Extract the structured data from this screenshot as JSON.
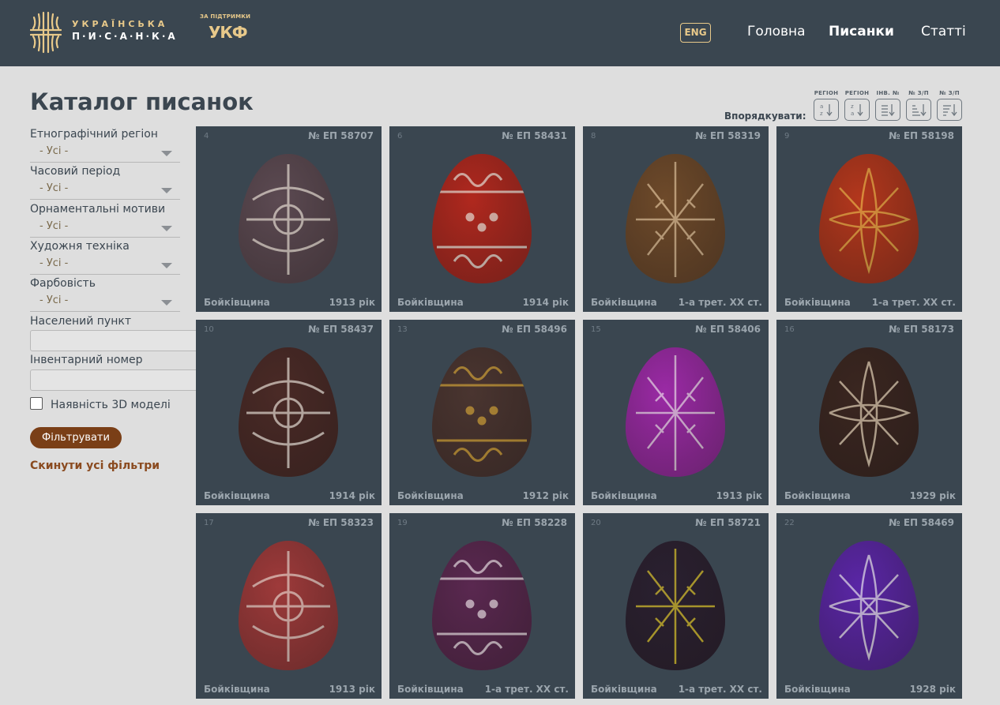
{
  "header": {
    "logo_line1": "УКРАЇНСЬКА",
    "logo_line2": "П·И·С·А·Н·К·А",
    "support_label": "ЗА ПІДТРИМКИ",
    "sponsor": "УКФ",
    "lang_button": "ENG",
    "nav": [
      {
        "label": "Головна"
      },
      {
        "label": "Писанки"
      },
      {
        "label": "Статті"
      }
    ]
  },
  "page_title": "Каталог писанок",
  "sort": {
    "label": "Впорядкувати:",
    "options": [
      {
        "caption": "РЕГІОН",
        "icon": "sort-alpha-asc-icon"
      },
      {
        "caption": "РЕГІОН",
        "icon": "sort-alpha-desc-icon"
      },
      {
        "caption": "ІНВ. №",
        "icon": "sort-inventory-icon"
      },
      {
        "caption": "№ З/П",
        "icon": "sort-number-asc-icon"
      },
      {
        "caption": "№ З/П",
        "icon": "sort-number-desc-icon"
      }
    ]
  },
  "filters": {
    "region": {
      "label": "Етнографічний регіон",
      "value": "- Усі -"
    },
    "period": {
      "label": "Часовий період",
      "value": "- Усі -"
    },
    "motifs": {
      "label": "Орнаментальні мотиви",
      "value": "- Усі -"
    },
    "technique": {
      "label": "Художня техніка",
      "value": "- Усі -"
    },
    "colors": {
      "label": "Фарбовість",
      "value": "- Усі -"
    },
    "settlement": {
      "label": "Населений пункт",
      "value": ""
    },
    "inventory": {
      "label": "Інвентарний номер",
      "value": ""
    },
    "model3d": {
      "label": "Наявність 3D моделі",
      "checked": false
    },
    "submit_label": "Фільтрувати",
    "reset_label": "Скинути усі фільтри"
  },
  "cards": [
    {
      "idx": "4",
      "inv": "№ ЕП 58707",
      "region": "Бойківщина",
      "year": "1913 рік",
      "base": "#5c4a52",
      "pattern": "#f0e6dc"
    },
    {
      "idx": "6",
      "inv": "№ ЕП 58431",
      "region": "Бойківщина",
      "year": "1914 рік",
      "base": "#b0281e",
      "pattern": "#f2e8de"
    },
    {
      "idx": "8",
      "inv": "№ ЕП 58319",
      "region": "Бойківщина",
      "year": "1-а трет. XX ст.",
      "base": "#6e4a2a",
      "pattern": "#e8c9a0"
    },
    {
      "idx": "9",
      "inv": "№ ЕП 58198",
      "region": "Бойківщина",
      "year": "1-а трет. XX ст.",
      "base": "#b3371c",
      "pattern": "#f0b74a"
    },
    {
      "idx": "10",
      "inv": "№ ЕП 58437",
      "region": "Бойківщина",
      "year": "1914 рік",
      "base": "#4a2a26",
      "pattern": "#efe5dc"
    },
    {
      "idx": "13",
      "inv": "№ ЕП 58496",
      "region": "Бойківщина",
      "year": "1912 рік",
      "base": "#4a3530",
      "pattern": "#d9a83a"
    },
    {
      "idx": "15",
      "inv": "№ ЕП 58406",
      "region": "Бойківщина",
      "year": "1913 рік",
      "base": "#9b2aa6",
      "pattern": "#f2e4f0"
    },
    {
      "idx": "16",
      "inv": "№ ЕП 58173",
      "region": "Бойківщина",
      "year": "1929 рік",
      "base": "#3a2620",
      "pattern": "#eedcc0"
    },
    {
      "idx": "17",
      "inv": "№ ЕП 58323",
      "region": "Бойківщина",
      "year": "1913 рік",
      "base": "#9e3a3a",
      "pattern": "#efd8d0"
    },
    {
      "idx": "19",
      "inv": "№ ЕП 58228",
      "region": "Бойківщина",
      "year": "1-а трет. XX ст.",
      "base": "#5a2850",
      "pattern": "#f0e2ea"
    },
    {
      "idx": "20",
      "inv": "№ ЕП 58721",
      "region": "Бойківщина",
      "year": "1-а трет. XX ст.",
      "base": "#2a2030",
      "pattern": "#e8d030"
    },
    {
      "idx": "22",
      "inv": "№ ЕП 58469",
      "region": "Бойківщина",
      "year": "1928 рік",
      "base": "#5a26a6",
      "pattern": "#f0ecf4"
    }
  ]
}
